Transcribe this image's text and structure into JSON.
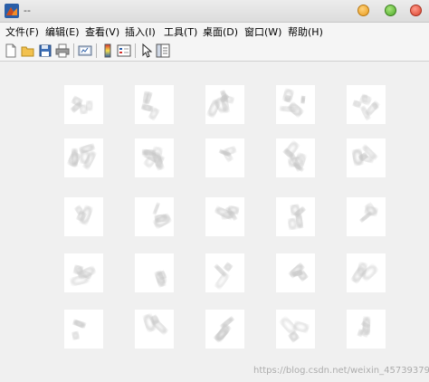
{
  "window": {
    "title": "--",
    "icon": "matlab-figure-icon"
  },
  "menu": {
    "items": [
      {
        "label": "文件(F)"
      },
      {
        "label": "编辑(E)"
      },
      {
        "label": "查看(V)"
      },
      {
        "label": "插入(I)"
      },
      {
        "label": "工具(T)"
      },
      {
        "label": "桌面(D)"
      },
      {
        "label": "窗口(W)"
      },
      {
        "label": "帮助(H)"
      }
    ]
  },
  "toolbar": {
    "buttons": [
      {
        "icon": "new-file-icon"
      },
      {
        "icon": "open-folder-icon"
      },
      {
        "icon": "save-disk-icon"
      },
      {
        "icon": "print-icon"
      },
      {
        "icon": "link-figure-icon"
      },
      {
        "icon": "colorbar-icon"
      },
      {
        "icon": "legend-icon"
      },
      {
        "icon": "pointer-arrow-icon"
      },
      {
        "icon": "property-editor-icon"
      }
    ]
  },
  "figure": {
    "rows": 5,
    "cols": 5,
    "cell_color": "#ffffff",
    "blur_color": "#c8c8c8"
  },
  "watermark": "https://blog.csdn.net/weixin_45739379"
}
